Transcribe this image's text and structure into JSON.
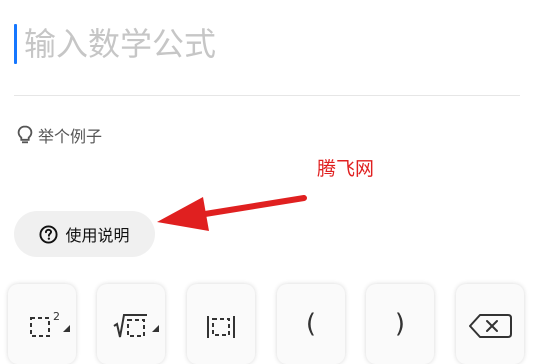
{
  "input": {
    "placeholder": "输入数学公式",
    "value": ""
  },
  "example": {
    "label": "举个例子"
  },
  "watermark": {
    "text": "腾飞网",
    "color": "#e02020"
  },
  "help": {
    "label": "使用说明"
  },
  "keyboard": {
    "keys": [
      {
        "name": "superscript-key",
        "symbol": "□²",
        "has_more": true
      },
      {
        "name": "radical-key",
        "symbol": "√□",
        "has_more": true
      },
      {
        "name": "absolute-value-key",
        "symbol": "|□|",
        "has_more": false
      },
      {
        "name": "left-paren-key",
        "symbol": "(",
        "has_more": false
      },
      {
        "name": "right-paren-key",
        "symbol": ")",
        "has_more": false
      },
      {
        "name": "backspace-key",
        "symbol": "⌫",
        "has_more": false
      }
    ]
  },
  "colors": {
    "accent": "#1677ff",
    "annotation": "#e02020"
  }
}
